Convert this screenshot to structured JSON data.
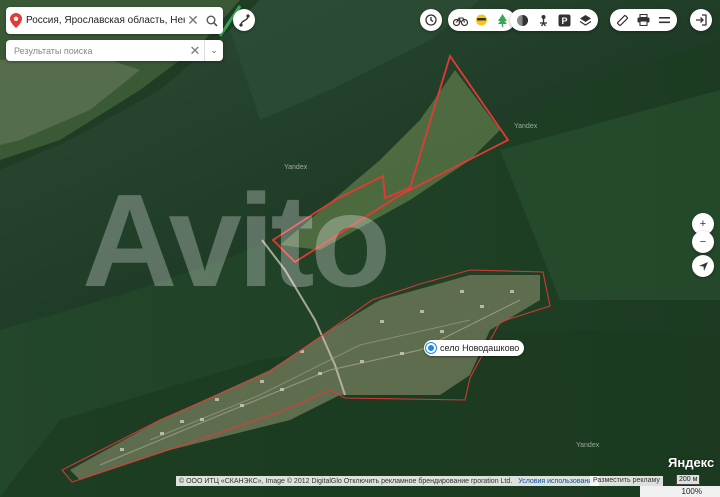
{
  "search": {
    "query": "Россия, Ярославская область, Некрасов",
    "results_placeholder": "Результаты поиска"
  },
  "place": {
    "label": "село Новодашково"
  },
  "watermark": {
    "text": "Avito"
  },
  "map_marks": [
    "Yandex",
    "Yandex",
    "Yandex"
  ],
  "attribution": {
    "text": "© ООО ИТЦ «СКАНЭКС», Image © 2012 DigitalGlo  Отключить рекламное брендирование  rporation Ltd.",
    "terms": "Условия использования",
    "ads": "Разместить рекламу"
  },
  "brand": "Яндекс",
  "scale_label": "200 м",
  "zoom_label": "100%",
  "icons": [
    "location-pin-icon",
    "clear-icon",
    "search-icon",
    "route-icon",
    "history-icon",
    "bike-icon",
    "traffic-icon",
    "park-icon",
    "panorama-icon",
    "transit-icon",
    "parking-icon",
    "layers-icon",
    "ruler-icon",
    "print-icon",
    "menu-icon",
    "login-icon",
    "zoom-in-icon",
    "zoom-out-icon",
    "geolocation-icon"
  ],
  "colors": {
    "boundary": "#e53935",
    "accent": "#1e88e5",
    "pin": "#e53935",
    "forest": "#1d3a22",
    "river": "#16331f"
  }
}
